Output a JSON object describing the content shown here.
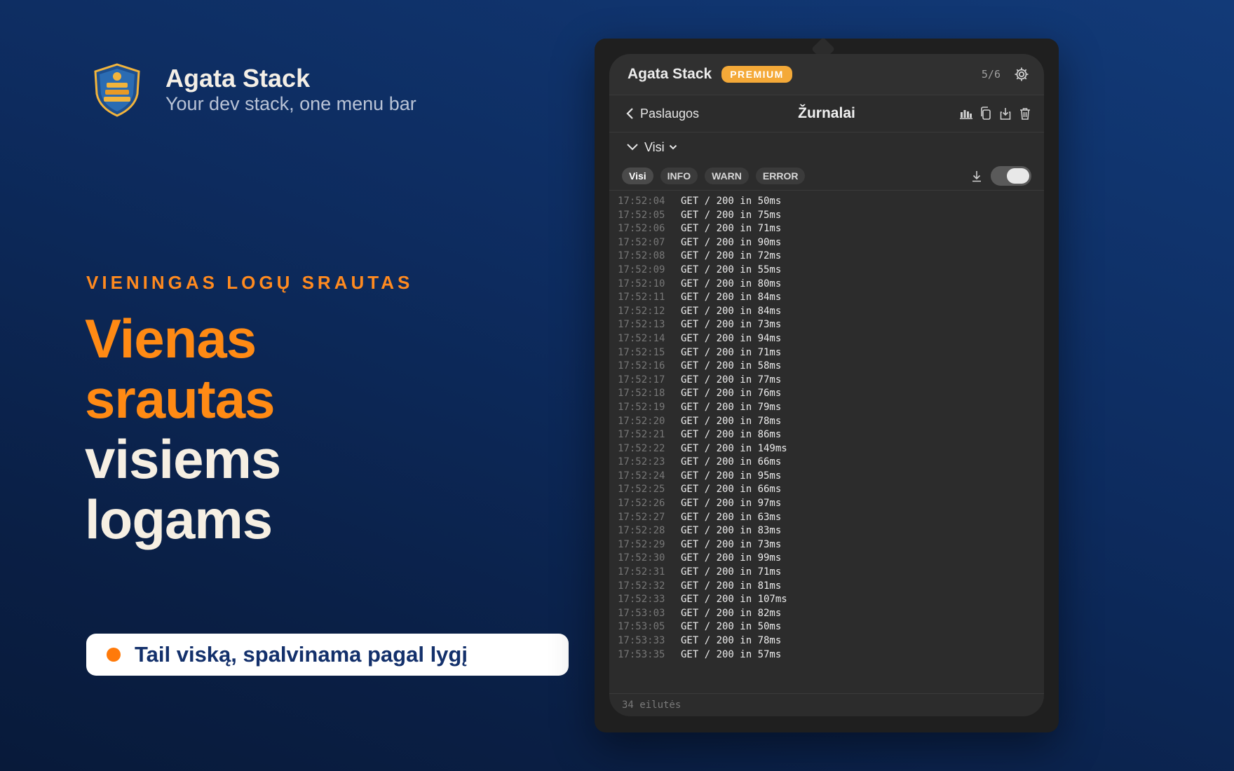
{
  "brand": {
    "name": "Agata Stack",
    "tagline": "Your dev stack, one menu bar"
  },
  "hero": {
    "eyebrow": "VIENINGAS LOGŲ SRAUTAS",
    "headline_orange_1": "Vienas",
    "headline_orange_2": "srautas",
    "headline_white_1": "visiems",
    "headline_white_2": "logams",
    "feature": "Tail viską, spalvinama pagal lygį"
  },
  "colors": {
    "accent": "#ff8a14",
    "premium": "#f4a938",
    "navy": "#13306b"
  },
  "app": {
    "title": "Agata Stack",
    "badge": "PREMIUM",
    "counter": "5/6",
    "back_label": "Paslaugos",
    "page_title": "Žurnalai",
    "source_label": "Visi",
    "filters": [
      "Visi",
      "INFO",
      "WARN",
      "ERROR"
    ],
    "active_filter": "Visi",
    "auto_scroll": true,
    "icons": [
      "bar-chart-icon",
      "copy-icon",
      "export-icon",
      "trash-icon",
      "download-icon",
      "gear-icon"
    ],
    "logs": [
      {
        "t": "17:52:04",
        "m": "GET / 200 in 50ms"
      },
      {
        "t": "17:52:05",
        "m": "GET / 200 in 75ms"
      },
      {
        "t": "17:52:06",
        "m": "GET / 200 in 71ms"
      },
      {
        "t": "17:52:07",
        "m": "GET / 200 in 90ms"
      },
      {
        "t": "17:52:08",
        "m": "GET / 200 in 72ms"
      },
      {
        "t": "17:52:09",
        "m": "GET / 200 in 55ms"
      },
      {
        "t": "17:52:10",
        "m": "GET / 200 in 80ms"
      },
      {
        "t": "17:52:11",
        "m": "GET / 200 in 84ms"
      },
      {
        "t": "17:52:12",
        "m": "GET / 200 in 84ms"
      },
      {
        "t": "17:52:13",
        "m": "GET / 200 in 73ms"
      },
      {
        "t": "17:52:14",
        "m": "GET / 200 in 94ms"
      },
      {
        "t": "17:52:15",
        "m": "GET / 200 in 71ms"
      },
      {
        "t": "17:52:16",
        "m": "GET / 200 in 58ms"
      },
      {
        "t": "17:52:17",
        "m": "GET / 200 in 77ms"
      },
      {
        "t": "17:52:18",
        "m": "GET / 200 in 76ms"
      },
      {
        "t": "17:52:19",
        "m": "GET / 200 in 79ms"
      },
      {
        "t": "17:52:20",
        "m": "GET / 200 in 78ms"
      },
      {
        "t": "17:52:21",
        "m": "GET / 200 in 86ms"
      },
      {
        "t": "17:52:22",
        "m": "GET / 200 in 149ms"
      },
      {
        "t": "17:52:23",
        "m": "GET / 200 in 66ms"
      },
      {
        "t": "17:52:24",
        "m": "GET / 200 in 95ms"
      },
      {
        "t": "17:52:25",
        "m": "GET / 200 in 66ms"
      },
      {
        "t": "17:52:26",
        "m": "GET / 200 in 97ms"
      },
      {
        "t": "17:52:27",
        "m": "GET / 200 in 63ms"
      },
      {
        "t": "17:52:28",
        "m": "GET / 200 in 83ms"
      },
      {
        "t": "17:52:29",
        "m": "GET / 200 in 73ms"
      },
      {
        "t": "17:52:30",
        "m": "GET / 200 in 99ms"
      },
      {
        "t": "17:52:31",
        "m": "GET / 200 in 71ms"
      },
      {
        "t": "17:52:32",
        "m": "GET / 200 in 81ms"
      },
      {
        "t": "17:52:33",
        "m": "GET / 200 in 107ms"
      },
      {
        "t": "17:53:03",
        "m": "GET / 200 in 82ms"
      },
      {
        "t": "17:53:05",
        "m": "GET / 200 in 50ms"
      },
      {
        "t": "17:53:33",
        "m": "GET / 200 in 78ms"
      },
      {
        "t": "17:53:35",
        "m": "GET / 200 in 57ms"
      }
    ],
    "footer": "34 eilutės"
  }
}
